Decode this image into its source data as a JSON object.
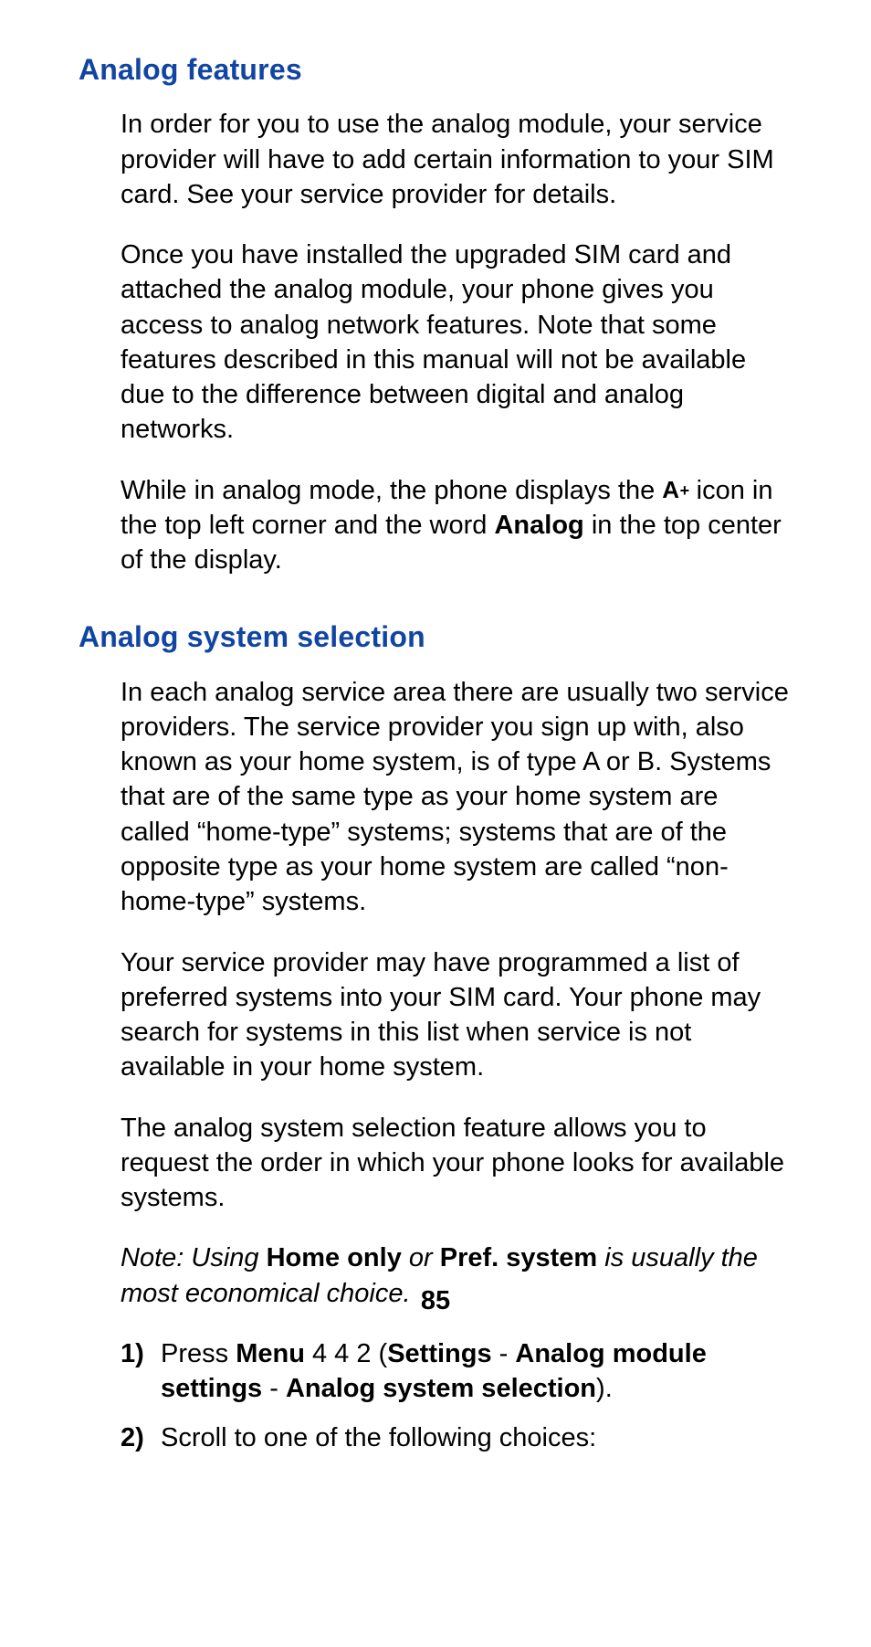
{
  "section1": {
    "heading": "Analog features",
    "p1": "In order for you to use the analog module, your service provider will have to add certain information to your SIM card. See your service provider for details.",
    "p2": "Once you have installed the upgraded SIM card and attached the analog module, your phone gives you access to analog network features. Note that some features described in this manual will not be available due to the difference between digital and analog networks.",
    "p3a": "While in analog mode, the phone displays the ",
    "icon_name": "A+",
    "p3b": " icon in the top left corner and the word ",
    "p3_bold": "Analog",
    "p3c": " in the top center of the display."
  },
  "section2": {
    "heading": "Analog system selection",
    "p1": "In each analog service area there are usually two service providers. The service provider you sign up with, also known as your home system, is of type A or B. Systems that are of the same type as your home system are called “home-type” systems; systems that are of the opposite type as your home system are called “non-home-type” systems.",
    "p2": "Your service provider may have programmed a list of preferred systems into your SIM card. Your phone may search for systems in this list when service is not available in your home system.",
    "p3": "The analog system selection feature allows you to request the order in which your phone looks for available systems.",
    "note": {
      "pre": "Note: Using ",
      "b1": "Home only",
      "mid": " or ",
      "b2": "Pref. system",
      "post": " is usually the most economical choice."
    },
    "steps": [
      {
        "num": "1)",
        "t1": "Press ",
        "b1": "Menu",
        "t2": " 4 4 2 (",
        "b2": "Settings",
        "t3": " - ",
        "b3": "Analog module settings",
        "t4": " - ",
        "b4": "Analog system selection",
        "t5": ")."
      },
      {
        "num": "2)",
        "t1": "Scroll to one of the following choices:"
      }
    ]
  },
  "page_number": "85"
}
